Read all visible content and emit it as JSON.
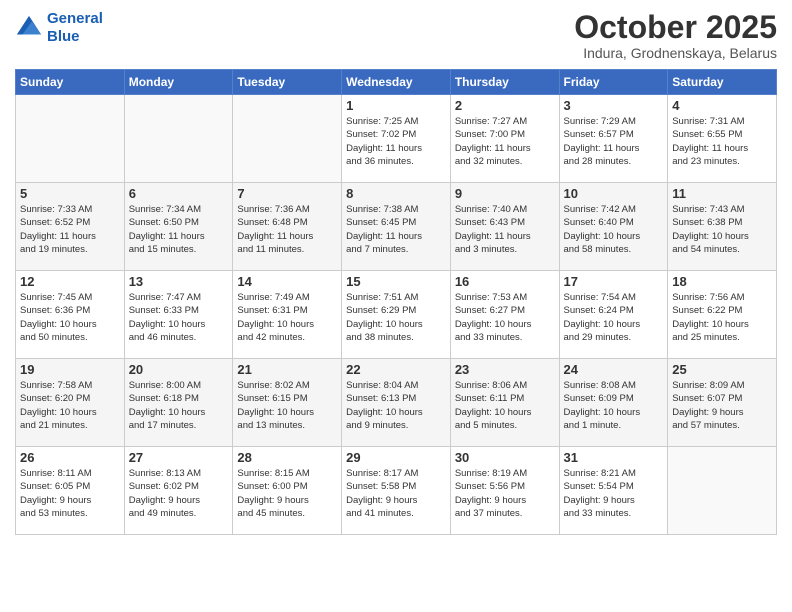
{
  "header": {
    "logo_line1": "General",
    "logo_line2": "Blue",
    "month_title": "October 2025",
    "location": "Indura, Grodnenskaya, Belarus"
  },
  "days_of_week": [
    "Sunday",
    "Monday",
    "Tuesday",
    "Wednesday",
    "Thursday",
    "Friday",
    "Saturday"
  ],
  "weeks": [
    [
      {
        "day": "",
        "text": ""
      },
      {
        "day": "",
        "text": ""
      },
      {
        "day": "",
        "text": ""
      },
      {
        "day": "1",
        "text": "Sunrise: 7:25 AM\nSunset: 7:02 PM\nDaylight: 11 hours\nand 36 minutes."
      },
      {
        "day": "2",
        "text": "Sunrise: 7:27 AM\nSunset: 7:00 PM\nDaylight: 11 hours\nand 32 minutes."
      },
      {
        "day": "3",
        "text": "Sunrise: 7:29 AM\nSunset: 6:57 PM\nDaylight: 11 hours\nand 28 minutes."
      },
      {
        "day": "4",
        "text": "Sunrise: 7:31 AM\nSunset: 6:55 PM\nDaylight: 11 hours\nand 23 minutes."
      }
    ],
    [
      {
        "day": "5",
        "text": "Sunrise: 7:33 AM\nSunset: 6:52 PM\nDaylight: 11 hours\nand 19 minutes."
      },
      {
        "day": "6",
        "text": "Sunrise: 7:34 AM\nSunset: 6:50 PM\nDaylight: 11 hours\nand 15 minutes."
      },
      {
        "day": "7",
        "text": "Sunrise: 7:36 AM\nSunset: 6:48 PM\nDaylight: 11 hours\nand 11 minutes."
      },
      {
        "day": "8",
        "text": "Sunrise: 7:38 AM\nSunset: 6:45 PM\nDaylight: 11 hours\nand 7 minutes."
      },
      {
        "day": "9",
        "text": "Sunrise: 7:40 AM\nSunset: 6:43 PM\nDaylight: 11 hours\nand 3 minutes."
      },
      {
        "day": "10",
        "text": "Sunrise: 7:42 AM\nSunset: 6:40 PM\nDaylight: 10 hours\nand 58 minutes."
      },
      {
        "day": "11",
        "text": "Sunrise: 7:43 AM\nSunset: 6:38 PM\nDaylight: 10 hours\nand 54 minutes."
      }
    ],
    [
      {
        "day": "12",
        "text": "Sunrise: 7:45 AM\nSunset: 6:36 PM\nDaylight: 10 hours\nand 50 minutes."
      },
      {
        "day": "13",
        "text": "Sunrise: 7:47 AM\nSunset: 6:33 PM\nDaylight: 10 hours\nand 46 minutes."
      },
      {
        "day": "14",
        "text": "Sunrise: 7:49 AM\nSunset: 6:31 PM\nDaylight: 10 hours\nand 42 minutes."
      },
      {
        "day": "15",
        "text": "Sunrise: 7:51 AM\nSunset: 6:29 PM\nDaylight: 10 hours\nand 38 minutes."
      },
      {
        "day": "16",
        "text": "Sunrise: 7:53 AM\nSunset: 6:27 PM\nDaylight: 10 hours\nand 33 minutes."
      },
      {
        "day": "17",
        "text": "Sunrise: 7:54 AM\nSunset: 6:24 PM\nDaylight: 10 hours\nand 29 minutes."
      },
      {
        "day": "18",
        "text": "Sunrise: 7:56 AM\nSunset: 6:22 PM\nDaylight: 10 hours\nand 25 minutes."
      }
    ],
    [
      {
        "day": "19",
        "text": "Sunrise: 7:58 AM\nSunset: 6:20 PM\nDaylight: 10 hours\nand 21 minutes."
      },
      {
        "day": "20",
        "text": "Sunrise: 8:00 AM\nSunset: 6:18 PM\nDaylight: 10 hours\nand 17 minutes."
      },
      {
        "day": "21",
        "text": "Sunrise: 8:02 AM\nSunset: 6:15 PM\nDaylight: 10 hours\nand 13 minutes."
      },
      {
        "day": "22",
        "text": "Sunrise: 8:04 AM\nSunset: 6:13 PM\nDaylight: 10 hours\nand 9 minutes."
      },
      {
        "day": "23",
        "text": "Sunrise: 8:06 AM\nSunset: 6:11 PM\nDaylight: 10 hours\nand 5 minutes."
      },
      {
        "day": "24",
        "text": "Sunrise: 8:08 AM\nSunset: 6:09 PM\nDaylight: 10 hours\nand 1 minute."
      },
      {
        "day": "25",
        "text": "Sunrise: 8:09 AM\nSunset: 6:07 PM\nDaylight: 9 hours\nand 57 minutes."
      }
    ],
    [
      {
        "day": "26",
        "text": "Sunrise: 8:11 AM\nSunset: 6:05 PM\nDaylight: 9 hours\nand 53 minutes."
      },
      {
        "day": "27",
        "text": "Sunrise: 8:13 AM\nSunset: 6:02 PM\nDaylight: 9 hours\nand 49 minutes."
      },
      {
        "day": "28",
        "text": "Sunrise: 8:15 AM\nSunset: 6:00 PM\nDaylight: 9 hours\nand 45 minutes."
      },
      {
        "day": "29",
        "text": "Sunrise: 8:17 AM\nSunset: 5:58 PM\nDaylight: 9 hours\nand 41 minutes."
      },
      {
        "day": "30",
        "text": "Sunrise: 8:19 AM\nSunset: 5:56 PM\nDaylight: 9 hours\nand 37 minutes."
      },
      {
        "day": "31",
        "text": "Sunrise: 8:21 AM\nSunset: 5:54 PM\nDaylight: 9 hours\nand 33 minutes."
      },
      {
        "day": "",
        "text": ""
      }
    ]
  ]
}
